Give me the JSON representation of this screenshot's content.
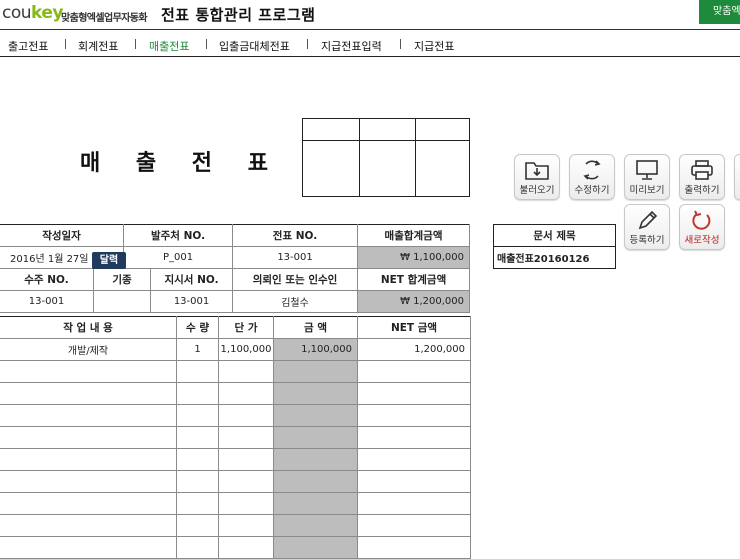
{
  "header": {
    "logo_prefix": "cou",
    "logo_accent": "key",
    "logo_sub": "맞춤형엑셀업무자동화",
    "app_title": "전표 통합관리 프로그램",
    "top_right_label": "맞춤엑"
  },
  "nav": {
    "items": [
      {
        "label": "출고전표"
      },
      {
        "label": "회계전표"
      },
      {
        "label": "매출전표"
      },
      {
        "label": "입출금대체전표"
      },
      {
        "label": "지급전표입력"
      },
      {
        "label": "지급전표"
      }
    ],
    "active": "매출전표"
  },
  "document": {
    "title": "매 출 전 표"
  },
  "info_table": {
    "headers_row1": [
      "작성일자",
      "발주처 NO.",
      "전표 NO.",
      "매출합계금액"
    ],
    "values_row1": [
      "2016년 1월 27일",
      "P_001",
      "13-001",
      "₩  1,100,000"
    ],
    "headers_row2": [
      "수주 NO.",
      "기종",
      "지시서 NO.",
      "의뢰인 또는 인수인",
      "NET 합계금액"
    ],
    "values_row2": [
      "13-001",
      "",
      "13-001",
      "김철수",
      "₩  1,200,000"
    ],
    "calendar_button": "달력"
  },
  "items_table": {
    "headers": [
      "작 업 내 용",
      "수 량",
      "단 가",
      "금      액",
      "NET 금액"
    ],
    "rows": [
      [
        "개발/제작",
        "1",
        "1,100,000",
        "1,100,000",
        "1,200,000"
      ],
      [
        "",
        "",
        "",
        "",
        ""
      ],
      [
        "",
        "",
        "",
        "",
        ""
      ],
      [
        "",
        "",
        "",
        "",
        ""
      ],
      [
        "",
        "",
        "",
        "",
        ""
      ],
      [
        "",
        "",
        "",
        "",
        ""
      ],
      [
        "",
        "",
        "",
        "",
        ""
      ],
      [
        "",
        "",
        "",
        "",
        ""
      ],
      [
        "",
        "",
        "",
        "",
        ""
      ],
      [
        "",
        "",
        "",
        "",
        ""
      ]
    ]
  },
  "doc_title_box": {
    "header": "문서 제목",
    "value": "매출전표20160126"
  },
  "toolbar": {
    "load": "불러오기",
    "edit": "수정하기",
    "preview": "미리보기",
    "print": "출력하기",
    "register": "등록하기",
    "new": "새로작성"
  },
  "colors": {
    "brand_green": "#86b817",
    "accent_green": "#1e8a3c",
    "badge_navy": "#1f3a5c",
    "grey_cell": "#bdbdbd",
    "new_red": "#b22222"
  }
}
